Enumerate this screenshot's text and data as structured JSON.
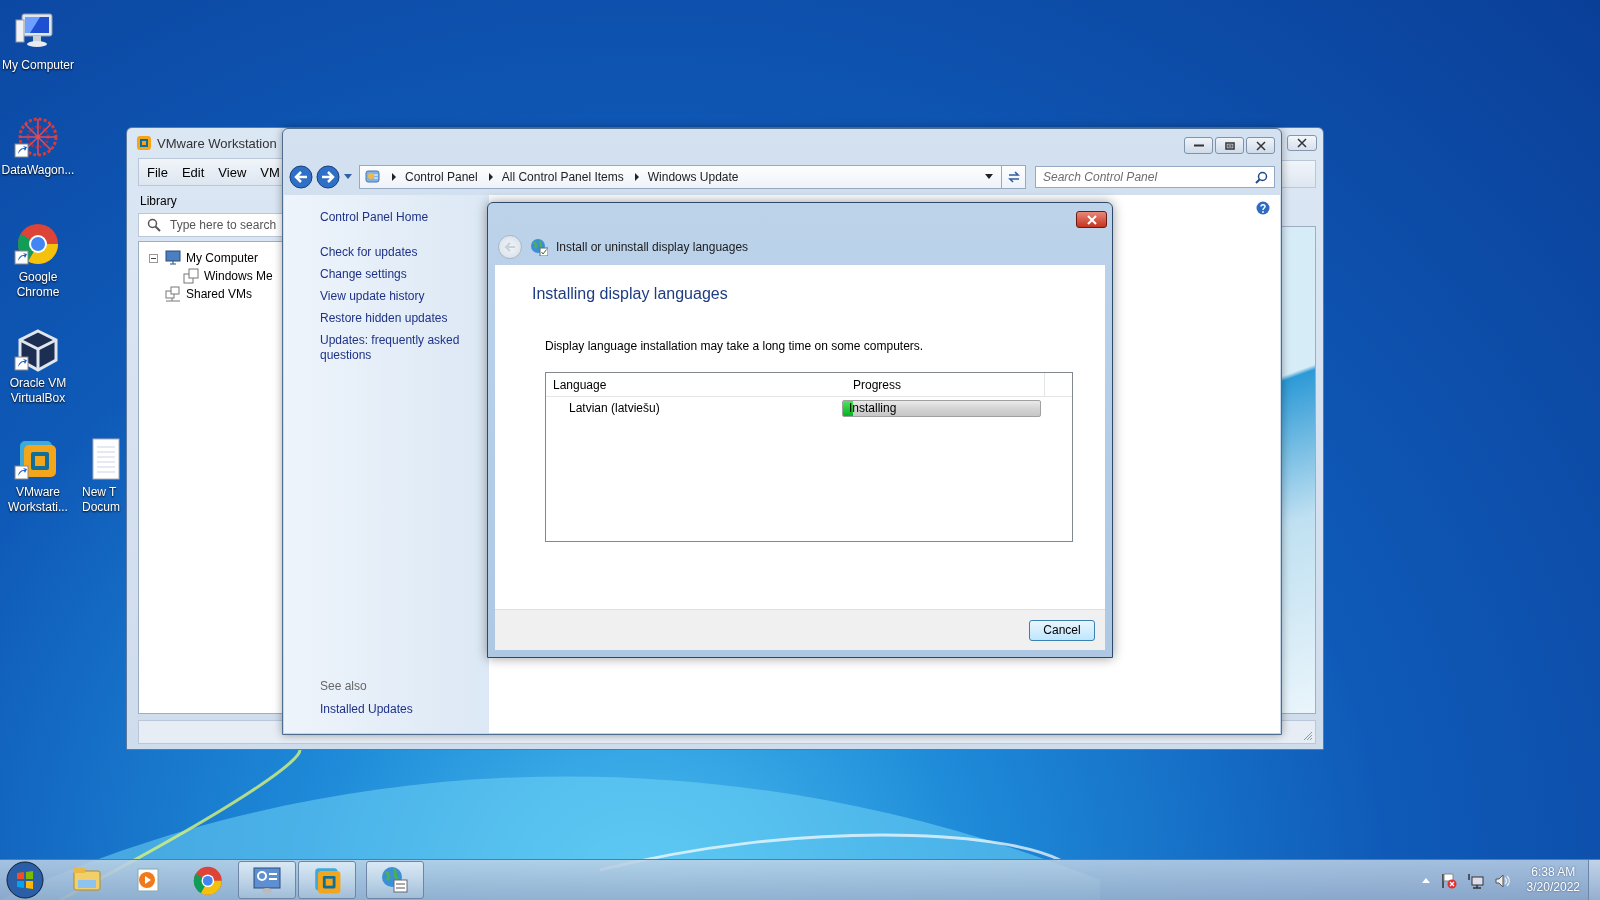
{
  "desktop": {
    "icons": [
      {
        "kind": "computer",
        "label": "My Computer",
        "shortcut": false
      },
      {
        "kind": "star",
        "label": "DataWagon...",
        "shortcut": true
      },
      {
        "kind": "chrome",
        "label": "Google Chrome",
        "shortcut": true
      },
      {
        "kind": "cube",
        "label": "Oracle VM VirtualBox",
        "shortcut": true
      },
      {
        "kind": "vmware",
        "label": "VMware Workstati...",
        "shortcut": true
      },
      {
        "kind": "document",
        "label": "New T Docum",
        "shortcut": false
      }
    ]
  },
  "vmware_window": {
    "title": "VMware Workstation",
    "menu": [
      "File",
      "Edit",
      "View",
      "VM"
    ],
    "library_label": "Library",
    "search": {
      "placeholder": "Type here to search"
    },
    "tree": [
      {
        "label": "My Computer",
        "kind": "computer",
        "expanded": true,
        "children": [
          {
            "label": "Windows Me",
            "kind": "vm"
          }
        ]
      },
      {
        "label": "Shared VMs",
        "kind": "shared"
      }
    ]
  },
  "control_panel": {
    "breadcrumb": [
      "Control Panel",
      "All Control Panel Items",
      "Windows Update"
    ],
    "search": {
      "placeholder": "Search Control Panel"
    },
    "sidebar": {
      "links": [
        "Control Panel Home",
        "Check for updates",
        "Change settings",
        "View update history",
        "Restore hidden updates",
        "Updates: frequently asked questions"
      ],
      "see_also_label": "See also",
      "see_also": [
        "Installed Updates"
      ]
    }
  },
  "dialog": {
    "title": "Install or uninstall display languages",
    "back_enabled": false,
    "heading": "Installing display languages",
    "message": "Display language installation may take a long time on some computers.",
    "list": {
      "columns": [
        "Language",
        "Progress"
      ],
      "rows": [
        {
          "language": "Latvian (latviešu)",
          "status": "Installing",
          "level": 0.05
        }
      ]
    },
    "buttons": [
      "Cancel"
    ]
  },
  "taskbar": {
    "items": [
      {
        "kind": "folder",
        "active": false
      },
      {
        "kind": "media",
        "active": false
      },
      {
        "kind": "chrome",
        "active": false
      },
      {
        "kind": "panel",
        "active": true
      },
      {
        "kind": "vmware",
        "active": true
      },
      {
        "kind": "globe",
        "active": true
      }
    ],
    "clock": {
      "time": "6:38 AM",
      "date": "3/20/2022"
    }
  }
}
